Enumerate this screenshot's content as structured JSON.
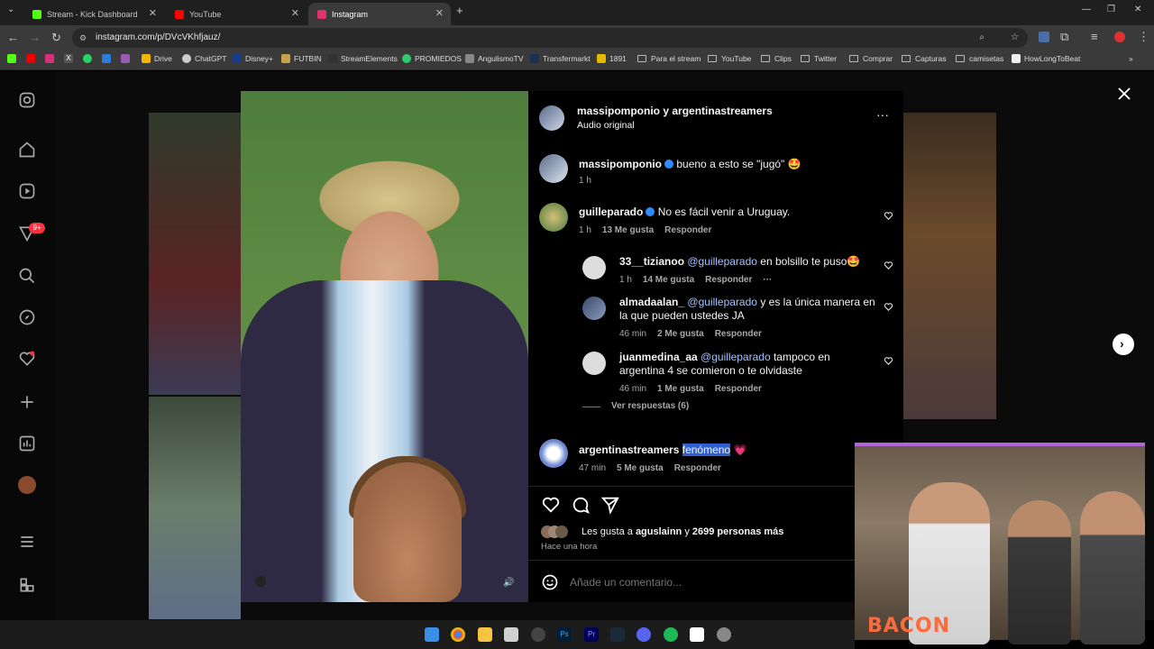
{
  "browser": {
    "tabs": [
      {
        "title": "Stream - Kick Dashboard",
        "color": "#53fc18"
      },
      {
        "title": "YouTube",
        "color": "#ff0000"
      },
      {
        "title": "Instagram",
        "color": "#e1306c"
      }
    ],
    "url": "instagram.com/p/DVcVKhfjauz/",
    "bookmarks": [
      "Drive",
      "ChatGPT",
      "Disney+",
      "FUTBIN",
      "StreamElements",
      "PROMIEDOS",
      "AngulismoTV",
      "Transfermarkt",
      "1891",
      "Para el stream",
      "YouTube",
      "Clips",
      "Twitter",
      "Comprar",
      "Capturas",
      "camisetas",
      "HowLongToBeat"
    ]
  },
  "sidebar": {
    "notification_badge": "9+",
    "icons": [
      "instagram-logo-icon",
      "home-icon",
      "reels-icon",
      "notifications-icon",
      "search-icon",
      "explore-icon",
      "heart-icon",
      "create-icon",
      "dashboard-icon",
      "profile-avatar",
      "menu-icon",
      "more-apps-icon"
    ]
  },
  "post": {
    "header_users": "massipomponio y argentinastreamers",
    "header_audio": "Audio original",
    "caption": {
      "user": "massipomponio",
      "text": "bueno a esto se \"jugó\" 🤩",
      "time": "1 h"
    },
    "comments": [
      {
        "user": "guilleparado",
        "verified": true,
        "text": "No es fácil venir a Uruguay.",
        "time": "1 h",
        "likes": "13 Me gusta",
        "reply": "Responder",
        "replies": [
          {
            "user": "33__tizianoo",
            "mention": "@guilleparado",
            "text": "en bolsillo te puso🤩",
            "time": "1 h",
            "likes": "14 Me gusta",
            "reply": "Responder",
            "more": "···"
          },
          {
            "user": "almadaalan_",
            "mention": "@guilleparado",
            "text": "y es la única manera en la que pueden ustedes JA",
            "time": "46 min",
            "likes": "2 Me gusta",
            "reply": "Responder"
          },
          {
            "user": "juanmedina_aa",
            "mention": "@guilleparado",
            "text": "tampoco en argentina 4 se comieron o te olvidaste",
            "time": "46 min",
            "likes": "1 Me gusta",
            "reply": "Responder"
          }
        ],
        "view_replies": "Ver respuestas (6)"
      },
      {
        "user": "argentinastreamers",
        "text": "fenómeno",
        "emoji": "💗",
        "time": "47 min",
        "likes": "5 Me gusta",
        "reply": "Responder"
      }
    ],
    "likes_prefix": "Les gusta a",
    "likes_user": "aguslainn",
    "likes_suffix": "y",
    "likes_count": "2699 personas más",
    "posted": "Hace una hora",
    "comment_placeholder": "Añade un comentario..."
  },
  "overlay": {
    "webcam_label": "BACON"
  }
}
